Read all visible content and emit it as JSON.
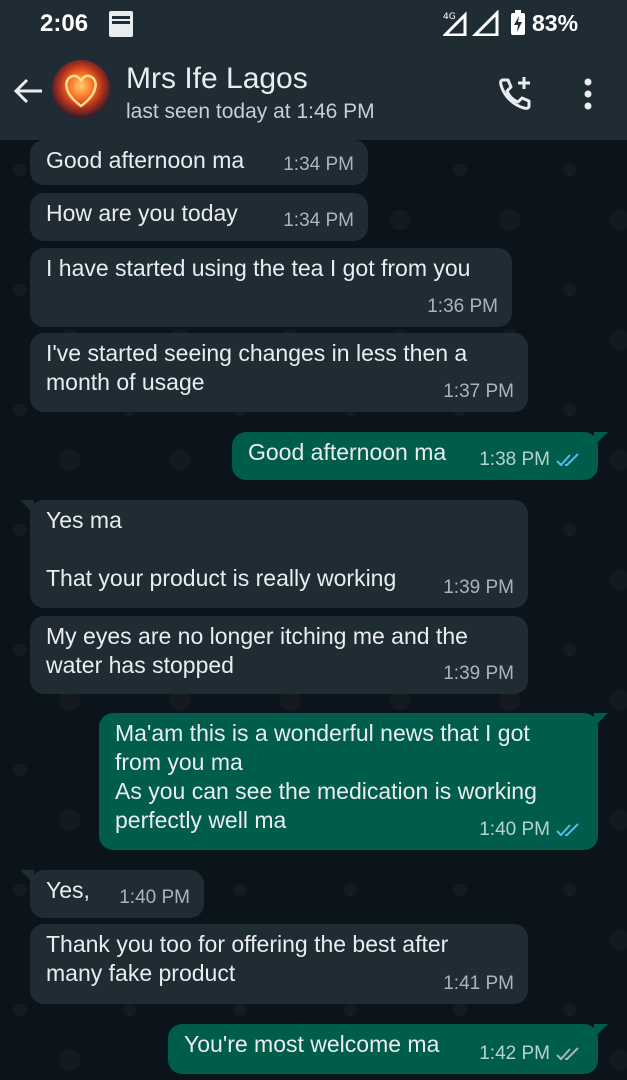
{
  "status_bar": {
    "time": "2:06",
    "battery": "83%",
    "network": "4G"
  },
  "header": {
    "contact_name": "Mrs Ife Lagos",
    "last_seen": "last seen today at 1:46 PM"
  },
  "messages": [
    {
      "dir": "in",
      "text": "Good afternoon ma",
      "time": "1:34 PM"
    },
    {
      "dir": "in",
      "text": "How are you today",
      "time": "1:34 PM"
    },
    {
      "dir": "in",
      "text": "I have started using the tea I got from you",
      "time": "1:36 PM"
    },
    {
      "dir": "in",
      "text": "I've started seeing changes in less then a\nmonth of usage",
      "time": "1:37 PM"
    },
    {
      "dir": "out",
      "text": "Good afternoon ma",
      "time": "1:38 PM",
      "read": true
    },
    {
      "dir": "in",
      "text": "Yes ma\n\nThat your product is really working",
      "time": "1:39 PM"
    },
    {
      "dir": "in",
      "text": "My eyes are no longer itching me and the\nwater has stopped",
      "time": "1:39 PM"
    },
    {
      "dir": "out",
      "text": "Ma'am this is a wonderful news that I got\nfrom you ma\nAs you can see the medication is working\nperfectly well ma",
      "time": "1:40 PM",
      "read": true
    },
    {
      "dir": "in",
      "text": "Yes,",
      "time": "1:40 PM"
    },
    {
      "dir": "in",
      "text": "Thank you too for offering the best after\nmany fake product",
      "time": "1:41 PM"
    },
    {
      "dir": "out",
      "text": "You're most welcome ma",
      "time": "1:42 PM",
      "read": false
    }
  ],
  "colors": {
    "header_bg": "#1f2c34",
    "chat_bg": "#0b141a",
    "incoming_bubble": "#202c33",
    "outgoing_bubble": "#005c4b",
    "read_tick": "#53bdeb",
    "sent_tick": "#aab4ba"
  },
  "icons": [
    "bible-icon",
    "signal-icon",
    "battery-icon",
    "back-arrow-icon",
    "add-call-icon",
    "more-options-icon",
    "double-tick-icon"
  ]
}
